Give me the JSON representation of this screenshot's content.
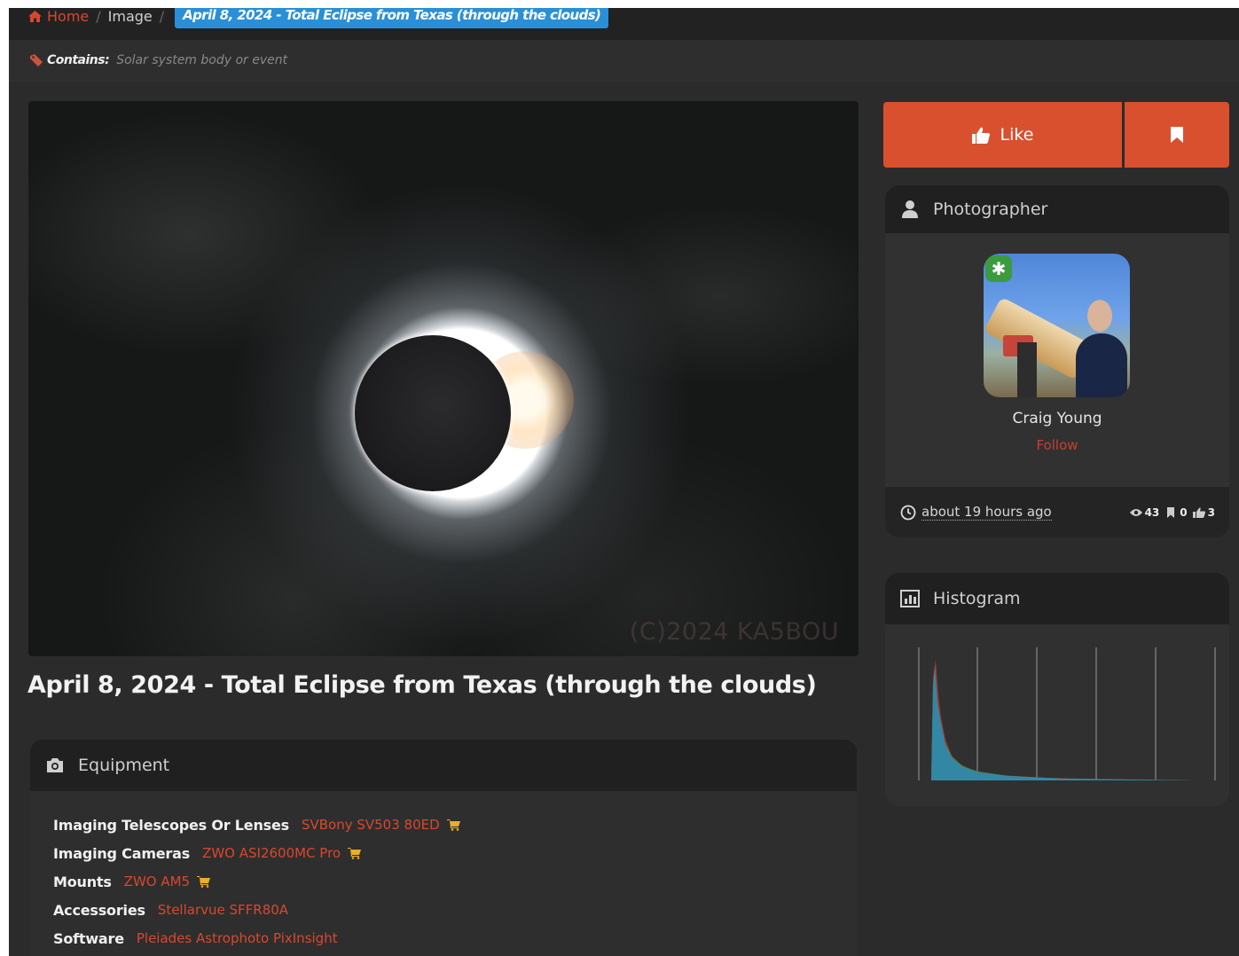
{
  "breadcrumb": {
    "home": "Home",
    "image": "Image",
    "current": "April 8, 2024 - Total Eclipse from Texas (through the clouds)"
  },
  "contains": {
    "label": "Contains:",
    "value": "Solar system body or event"
  },
  "photo": {
    "watermark": "(C)2024 KA5BOU"
  },
  "title": "April 8, 2024 - Total Eclipse from Texas (through the clouds)",
  "equipment": {
    "header": "Equipment",
    "rows": [
      {
        "label": "Imaging Telescopes Or Lenses",
        "value": "SVBony SV503 80ED",
        "cart": true
      },
      {
        "label": "Imaging Cameras",
        "value": "ZWO ASI2600MC Pro",
        "cart": true
      },
      {
        "label": "Mounts",
        "value": "ZWO AM5",
        "cart": true
      },
      {
        "label": "Accessories",
        "value": "Stellarvue SFFR80A",
        "cart": false
      },
      {
        "label": "Software",
        "value": "Pleiades Astrophoto PixInsight",
        "cart": false
      }
    ]
  },
  "actions": {
    "like": "Like"
  },
  "photographer": {
    "header": "Photographer",
    "name": "Craig Young",
    "follow": "Follow",
    "badge": "✱",
    "time_ago": "about 19 hours ago",
    "views": "43",
    "bookmarks": "0",
    "likes": "3"
  },
  "histogram": {
    "header": "Histogram"
  },
  "colors": {
    "accent": "#d9502f",
    "link": "#d9472e",
    "active_crumb": "#2a8fd6",
    "badge": "#3b9b3f"
  },
  "icons": [
    "home-icon",
    "tag-icon",
    "camera-icon",
    "cart-icon",
    "thumbs-up-icon",
    "bookmark-icon",
    "user-icon",
    "clock-icon",
    "eye-icon",
    "chart-icon"
  ]
}
